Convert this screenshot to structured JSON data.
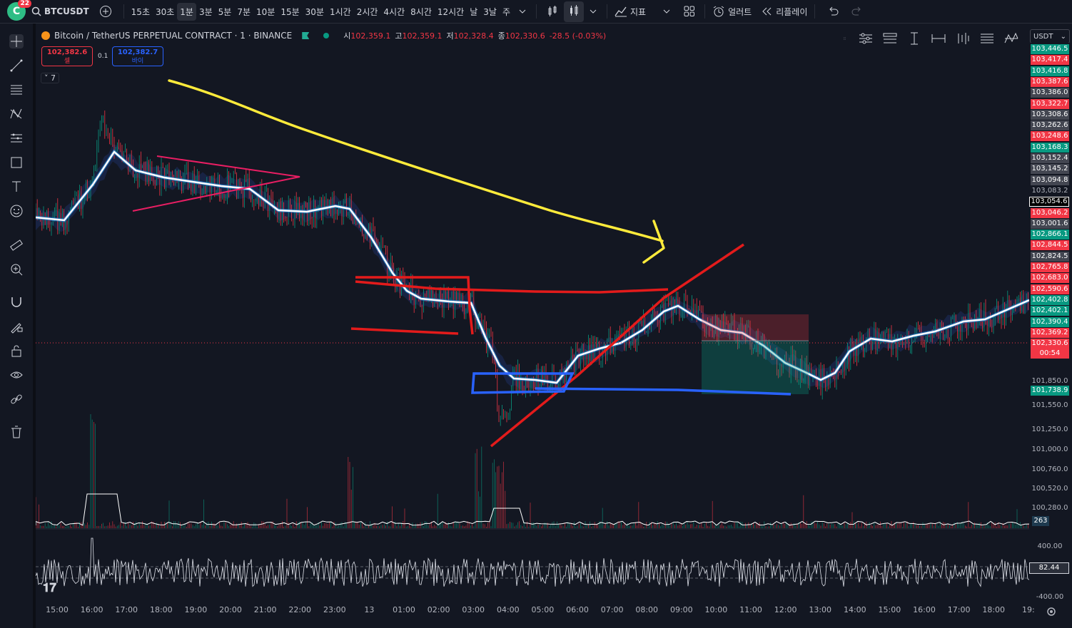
{
  "header": {
    "logo_letter": "C",
    "notification_count": "22",
    "symbol": "BTCUSDT",
    "intervals": [
      "15초",
      "30초",
      "1분",
      "3분",
      "5분",
      "7분",
      "10분",
      "15분",
      "30분",
      "1시간",
      "2시간",
      "4시간",
      "8시간",
      "12시간",
      "날",
      "3날",
      "주"
    ],
    "active_interval": "1분",
    "indicators_label": "지표",
    "alert_label": "얼러트",
    "replay_label": "리플레이"
  },
  "legend": {
    "title": "Bitcoin / TetherUS PERPETUAL CONTRACT · 1 · BINANCE",
    "open_label": "시",
    "open": "102,359.1",
    "high_label": "고",
    "high": "102,359.1",
    "low_label": "저",
    "low": "102,328.4",
    "close_label": "종",
    "close": "102,330.6",
    "change": "-28.5 (-0.03%)",
    "sell_price": "102,382.6",
    "sell_label": "셀",
    "buy_price": "102,382.7",
    "buy_label": "바이",
    "spread": "0.1",
    "collapse_count": "7"
  },
  "price_axis": {
    "currency": "USDT",
    "labels": [
      {
        "v": "103,446.5",
        "c": "green"
      },
      {
        "v": "103,417.4",
        "c": "red"
      },
      {
        "v": "103,416.8",
        "c": "green"
      },
      {
        "v": "103,387.6",
        "c": "red"
      },
      {
        "v": "103,386.0",
        "c": "gray"
      },
      {
        "v": "103,322.7",
        "c": "red"
      },
      {
        "v": "103,308.6",
        "c": "gray"
      },
      {
        "v": "103,262.6",
        "c": "gray"
      },
      {
        "v": "103,248.6",
        "c": "red"
      },
      {
        "v": "103,168.3",
        "c": "green"
      },
      {
        "v": "103,152.4",
        "c": "gray"
      },
      {
        "v": "103,145.2",
        "c": "gray"
      },
      {
        "v": "103,094.8",
        "c": "gray"
      },
      {
        "v": "103,083.2",
        "c": "plain"
      },
      {
        "v": "103,054.6",
        "c": "white"
      },
      {
        "v": "103,046.2",
        "c": "red"
      },
      {
        "v": "103,001.6",
        "c": "gray"
      },
      {
        "v": "102,866.1",
        "c": "green"
      },
      {
        "v": "102,844.5",
        "c": "red"
      },
      {
        "v": "102,824.5",
        "c": "gray"
      },
      {
        "v": "102,765.8",
        "c": "red"
      },
      {
        "v": "102,683.0",
        "c": "red"
      },
      {
        "v": "102,590.6",
        "c": "red"
      },
      {
        "v": "102,402.8",
        "c": "green"
      },
      {
        "v": "102,402.1",
        "c": "green"
      },
      {
        "v": "102,390.4",
        "c": "green"
      },
      {
        "v": "102,369.2",
        "c": "red"
      },
      {
        "v": "102,330.6",
        "c": "red"
      }
    ],
    "countdown": "00:54",
    "lower_labels": [
      "101,850.0",
      "101,550.0",
      "101,250.0",
      "101,000.0",
      "100,760.0",
      "100,520.0",
      "100,280.0"
    ],
    "lower_highlight": "101,738.9",
    "volume_label": "263",
    "osc_labels": [
      "400.00",
      "-400.00"
    ],
    "osc_value": "82.44"
  },
  "time_axis": [
    "15:00",
    "16:00",
    "17:00",
    "18:00",
    "19:00",
    "20:00",
    "21:00",
    "22:00",
    "23:00",
    "13",
    "01:00",
    "02:00",
    "03:00",
    "04:00",
    "05:00",
    "06:00",
    "07:00",
    "08:00",
    "09:00",
    "10:00",
    "11:00",
    "12:00",
    "13:00",
    "14:00",
    "15:00",
    "16:00",
    "17:00",
    "18:00",
    "19:"
  ],
  "colors": {
    "bg": "#131722",
    "up": "#089981",
    "down": "#f23645",
    "ma": "#ffffff",
    "arrow": "#ffeb3b",
    "triangle": "#e91e63",
    "red_lines": "#e31b1b",
    "blue_lines": "#2962ff"
  },
  "icons": [
    "crosshair-icon",
    "trend-line-icon",
    "fib-icon",
    "pattern-icon",
    "brush-icon",
    "rectangle-icon",
    "text-icon",
    "emoji-icon",
    "ruler-icon",
    "zoom-icon",
    "magnet-icon",
    "lock-draw-icon",
    "lock-icon",
    "eye-icon",
    "link-icon",
    "trash-icon"
  ]
}
